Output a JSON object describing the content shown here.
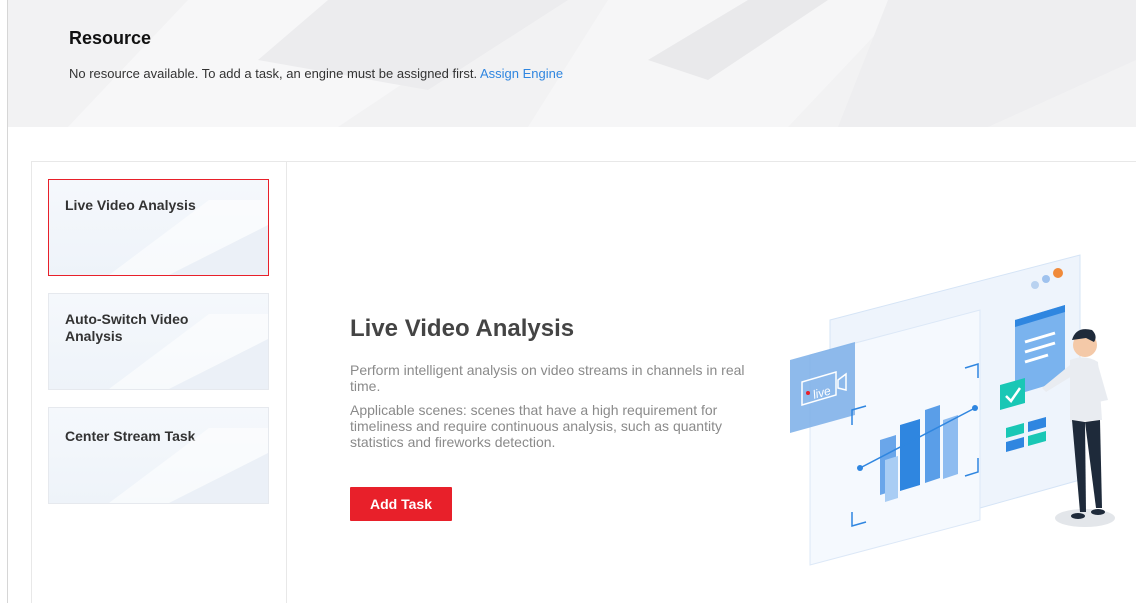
{
  "header": {
    "title": "Resource",
    "message": "No resource available. To add a task, an engine must be assigned first.",
    "link_label": "Assign Engine"
  },
  "sidebar": {
    "items": [
      {
        "label": "Live Video Analysis",
        "active": true
      },
      {
        "label": "Auto-Switch Video Analysis",
        "active": false
      },
      {
        "label": "Center Stream Task",
        "active": false
      }
    ]
  },
  "main": {
    "title": "Live Video Analysis",
    "description_1": "Perform intelligent analysis on video streams in channels in real time.",
    "description_2": "Applicable scenes: scenes that have a high requirement for timeliness and require continuous analysis, such as quantity statistics and fireworks detection.",
    "add_task_label": "Add Task",
    "illustration_badge": "live"
  },
  "colors": {
    "accent": "#e8202a",
    "link": "#2f86e0",
    "illustration_blue": "#2f86e0",
    "illustration_teal": "#19c7b5"
  }
}
